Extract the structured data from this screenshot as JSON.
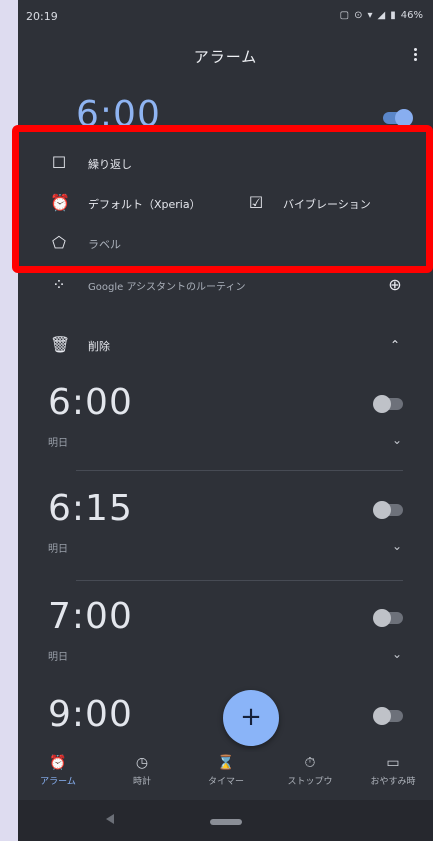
{
  "status_bar": {
    "time": "20:19",
    "icons": [
      "▢",
      "⊙",
      "▾",
      "◢",
      "▮"
    ],
    "battery": "46%"
  },
  "app_bar": {
    "title": "アラーム",
    "menu_icon": "kebab-menu-icon"
  },
  "expanded_alarm": {
    "time": "6:00",
    "enabled": true,
    "repeat_label": "繰り返し",
    "ringtone_label": "デフォルト（Xperia）",
    "vibrate_label": "バイブレーション",
    "vibrate_checked": true,
    "label_label": "ラベル",
    "assistant_label": "Google アシスタントのルーティン",
    "delete_label": "削除"
  },
  "alarms": [
    {
      "time": "6:00",
      "sub": "明日",
      "enabled": false
    },
    {
      "time": "6:15",
      "sub": "明日",
      "enabled": false
    },
    {
      "time": "7:00",
      "sub": "明日",
      "enabled": false
    },
    {
      "time": "9:00",
      "sub": "",
      "enabled": false
    }
  ],
  "fab": {
    "label": "+"
  },
  "bottom_nav": [
    {
      "label": "アラーム",
      "icon": "⏰",
      "active": true
    },
    {
      "label": "時計",
      "icon": "◷",
      "active": false
    },
    {
      "label": "タイマー",
      "icon": "⌛",
      "active": false
    },
    {
      "label": "ストップウ",
      "icon": "⏱",
      "active": false
    },
    {
      "label": "おやすみ時",
      "icon": "▭",
      "active": false
    }
  ],
  "colors": {
    "accent": "#8ab4f8",
    "highlight": "#ff0000",
    "background": "#2e3138"
  }
}
